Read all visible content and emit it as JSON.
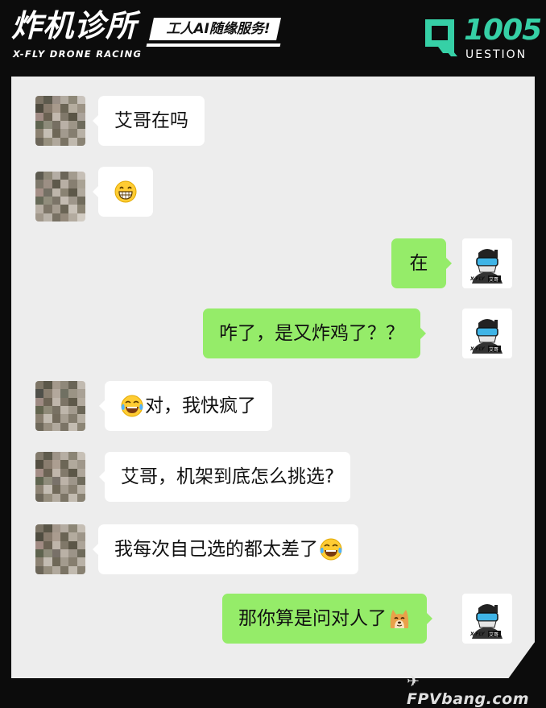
{
  "header": {
    "brand_title": "炸机诊所",
    "brand_subtitle": "X-FLY DRONE RACING",
    "slogan": "工人AI随缘服务!",
    "question_number": "1005",
    "question_word": "UESTION",
    "accent_color": "#36d0a6"
  },
  "chat": {
    "messages": [
      {
        "side": "in",
        "text": "艾哥在吗",
        "emoji_after": "",
        "avatar": "pixelated-avatar"
      },
      {
        "side": "in",
        "text": "",
        "emoji_after": "grin-emoji",
        "avatar": "pixelated-avatar"
      },
      {
        "side": "out",
        "text": "在",
        "emoji_after": "",
        "avatar": "xfly-pilot-avatar"
      },
      {
        "side": "out",
        "text": "咋了，是又炸鸡了？？",
        "emoji_after": "",
        "avatar": "xfly-pilot-avatar"
      },
      {
        "side": "in",
        "text": "对，我快疯了",
        "emoji_before": "tears-of-joy-emoji",
        "avatar": "pixelated-avatar"
      },
      {
        "side": "in",
        "text": "艾哥，机架到底怎么挑选?",
        "emoji_after": "",
        "avatar": "pixelated-avatar"
      },
      {
        "side": "in",
        "text": "我每次自己选的都太差了",
        "emoji_after": "tears-of-joy-emoji",
        "avatar": "pixelated-avatar"
      },
      {
        "side": "out",
        "text": "那你算是问对人了",
        "emoji_after": "doge-emoji",
        "avatar": "xfly-pilot-avatar"
      }
    ],
    "self_avatar_label": "X-FLY 艾哥",
    "incoming_bubble_color": "#ffffff",
    "outgoing_bubble_color": "#95ec69",
    "background_color": "#ededed"
  },
  "watermark": "FPVbang.com"
}
